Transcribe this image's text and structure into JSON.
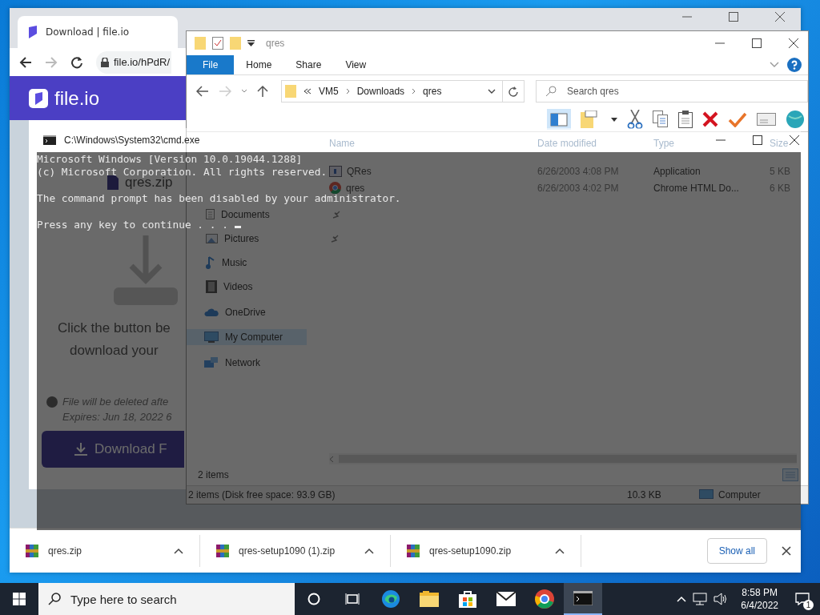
{
  "browser": {
    "tab_title": "Download | file.io",
    "url": "file.io/hPdR/",
    "site_name": "file.io",
    "file_name": "qres.zip",
    "prompt_lines": [
      "Click the button be",
      "download your"
    ],
    "notice": "File will be deleted afte",
    "expires": "Expires: Jun 18, 2022 6",
    "download_button": "Download F",
    "downloads": [
      {
        "name": "qres.zip"
      },
      {
        "name": "qres-setup1090 (1).zip"
      },
      {
        "name": "qres-setup1090.zip"
      }
    ],
    "show_all": "Show all"
  },
  "explorer": {
    "title": "qres",
    "ribbon_tabs": [
      {
        "label": "File",
        "selected": true
      },
      {
        "label": "Home",
        "selected": false
      },
      {
        "label": "Share",
        "selected": false
      },
      {
        "label": "View",
        "selected": false
      }
    ],
    "breadcrumb": [
      "VM5",
      "Downloads",
      "qres"
    ],
    "search": {
      "placeholder": "Search qres"
    },
    "columns": [
      "Name",
      "Date modified",
      "Type",
      "Size"
    ],
    "files": [
      {
        "name": "QRes",
        "kind": "app",
        "date": "6/26/2003 4:08 PM",
        "type": "Application",
        "size": "5 KB"
      },
      {
        "name": "qres",
        "kind": "html",
        "date": "6/26/2003 4:02 PM",
        "type": "Chrome HTML Do...",
        "size": "6 KB"
      }
    ],
    "nav": [
      {
        "label": "Documents",
        "kind": "documents",
        "pinned": true,
        "selected": false
      },
      {
        "label": "Pictures",
        "kind": "pictures",
        "pinned": true,
        "selected": false
      },
      {
        "label": "Music",
        "kind": "music",
        "pinned": false,
        "selected": false
      },
      {
        "label": "Videos",
        "kind": "videos",
        "pinned": false,
        "selected": false
      },
      {
        "label": "OneDrive",
        "kind": "onedrive",
        "pinned": false,
        "selected": false
      },
      {
        "label": "My Computer",
        "kind": "computer",
        "pinned": false,
        "selected": true
      },
      {
        "label": "Network",
        "kind": "network",
        "pinned": false,
        "selected": false
      }
    ],
    "item_count": "2 items",
    "status": "2 items (Disk free space: 93.9 GB)",
    "total_size": "10.3 KB",
    "location": "Computer"
  },
  "console": {
    "title": "C:\\Windows\\System32\\cmd.exe",
    "paragraphs": [
      [
        "Microsoft Windows [Version 10.0.19044.1288]",
        "(c) Microsoft Corporation. All rights reserved."
      ],
      [
        "The command prompt has been disabled by your administrator."
      ],
      [
        "Press any key to continue . . ."
      ]
    ]
  },
  "taskbar": {
    "search_placeholder": "Type here to search",
    "apps": [
      {
        "kind": "cortana",
        "active": false
      },
      {
        "kind": "taskview",
        "active": false
      },
      {
        "kind": "edge",
        "active": false
      },
      {
        "kind": "folder",
        "active": false
      },
      {
        "kind": "store",
        "active": false
      },
      {
        "kind": "mail",
        "active": false
      },
      {
        "kind": "chrome",
        "active": false
      },
      {
        "kind": "console",
        "active": true
      }
    ],
    "time": "8:58 PM",
    "date": "6/4/2022",
    "notification_count": "1"
  }
}
